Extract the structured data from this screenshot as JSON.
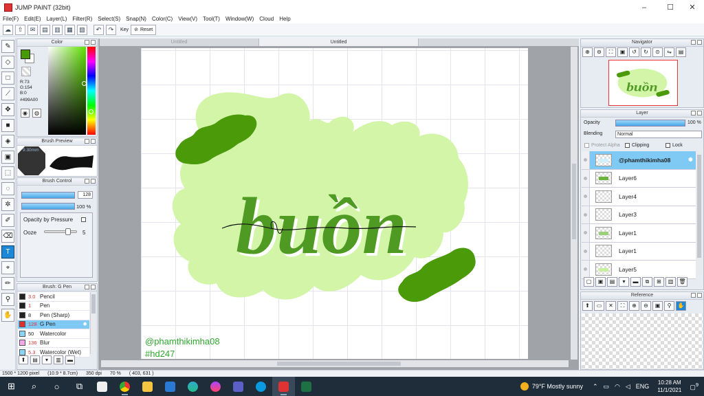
{
  "window": {
    "title": "JUMP PAINT (32bit)",
    "minimize": "–",
    "maximize": "☐",
    "close": "✕"
  },
  "menu": [
    "File(F)",
    "Edit(E)",
    "Layer(L)",
    "Filter(R)",
    "Select(S)",
    "Snap(N)",
    "Color(C)",
    "View(V)",
    "Tool(T)",
    "Window(W)",
    "Cloud",
    "Help"
  ],
  "toolbar": {
    "key_label": "Key",
    "reset_label": "Reset"
  },
  "color_panel": {
    "title": "Color",
    "fg_color": "#499a00",
    "r": "R:73",
    "g": "G:154",
    "b": "B:0",
    "hex": "#499A00"
  },
  "brush_preview": {
    "title": "Brush Preview",
    "size": "9.30mm"
  },
  "brush_control": {
    "title": "Brush Control",
    "size_value": "128",
    "opacity_value": "100 %",
    "opacity_by_pressure": "Opacity by Pressure",
    "ooze_label": "Ooze",
    "ooze_value": "5",
    "ooze_level": 0.8
  },
  "brush_list": {
    "title": "Brush: G Pen",
    "items": [
      {
        "size": "3.0",
        "name": "Pencil",
        "color": "#222222",
        "size_color": "#d33"
      },
      {
        "size": "1",
        "name": "Pen",
        "color": "#222222",
        "size_color": "#d33"
      },
      {
        "size": "8",
        "name": "Pen (Sharp)",
        "color": "#222222",
        "size_color": "#222"
      },
      {
        "size": "128",
        "name": "G Pen",
        "color": "#e03030",
        "size_color": "#d33"
      },
      {
        "size": "50",
        "name": "Watercolor",
        "color": "#8ad4f8",
        "size_color": "#222"
      },
      {
        "size": "136",
        "name": "Blur",
        "color": "#f4a8e8",
        "size_color": "#d33"
      },
      {
        "size": "5.3",
        "name": "Watercolor (Wet)",
        "color": "#8ad4f8",
        "size_color": "#d33"
      }
    ]
  },
  "canvas": {
    "tabs": [
      "Untitled",
      "Untitled"
    ],
    "lettering": "buồn",
    "watermark1": "@phamthikimha08",
    "watermark2": "#hd247"
  },
  "navigator": {
    "title": "Navigator"
  },
  "layer_panel": {
    "title": "Layer",
    "opacity_label": "Opacity",
    "opacity_value": "100 %",
    "blending_label": "Blending",
    "blending_value": "Normal",
    "protect_alpha": "Protect Alpha",
    "clipping": "Clipping",
    "lock": "Lock",
    "layers": [
      {
        "name": "@phamthikimha08"
      },
      {
        "name": "Layer6"
      },
      {
        "name": "Layer4"
      },
      {
        "name": "Layer3"
      },
      {
        "name": "Layer1"
      },
      {
        "name": "Layer1"
      },
      {
        "name": "Layer5"
      }
    ]
  },
  "reference": {
    "title": "Reference"
  },
  "status": {
    "size": "1500 * 1200 pixel",
    "physical": "(10.9 * 8.7cm)",
    "dpi": "350 dpi",
    "zoom": "70 %",
    "coords": "( 403, 631 )"
  },
  "taskbar": {
    "weather": "79°F  Mostly sunny",
    "lang": "ENG",
    "time": "10:28 AM",
    "date": "11/1/2021",
    "notifications": "9"
  },
  "colors": {
    "accent": "#1e88d8",
    "selection": "#7fcaf5",
    "letter_green": "#4f9a22",
    "blob_green": "#d2f5a8",
    "brush_green": "#4a9a0a"
  }
}
